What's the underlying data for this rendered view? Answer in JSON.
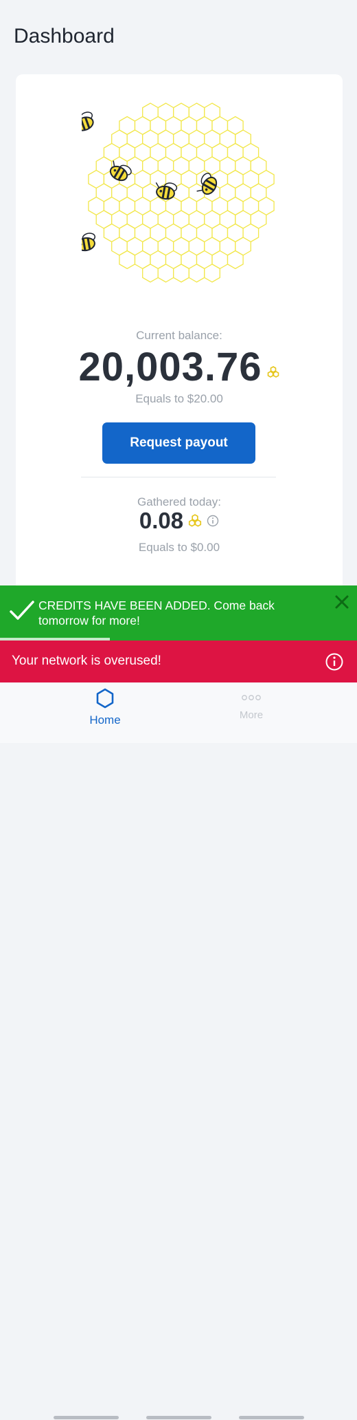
{
  "header": {
    "title": "Dashboard"
  },
  "balance": {
    "label": "Current balance:",
    "value": "20,003.76",
    "equals": "Equals to $20.00",
    "coin_icon": "honeycomb-coin-icon"
  },
  "actions": {
    "payout_label": "Request payout"
  },
  "today": {
    "label": "Gathered today:",
    "value": "0.08",
    "equals": "Equals to $0.00",
    "info_icon": "info-icon"
  },
  "notifications": {
    "success": {
      "text": "CREDITS HAVE BEEN ADDED. Come back tomorrow for more!",
      "icon": "checkmark-icon",
      "close_icon": "close-icon",
      "color": "#1fa82a"
    },
    "warning": {
      "text": "Your network is overused!",
      "icon": "info-icon",
      "color": "#dd1443"
    }
  },
  "nav": {
    "items": [
      {
        "label": "Home",
        "icon": "hexagon-icon",
        "active": true
      },
      {
        "label": "More",
        "icon": "dots-icon",
        "active": false
      }
    ]
  },
  "colors": {
    "accent": "#1366c9",
    "honeycomb": "#f2e74a"
  }
}
